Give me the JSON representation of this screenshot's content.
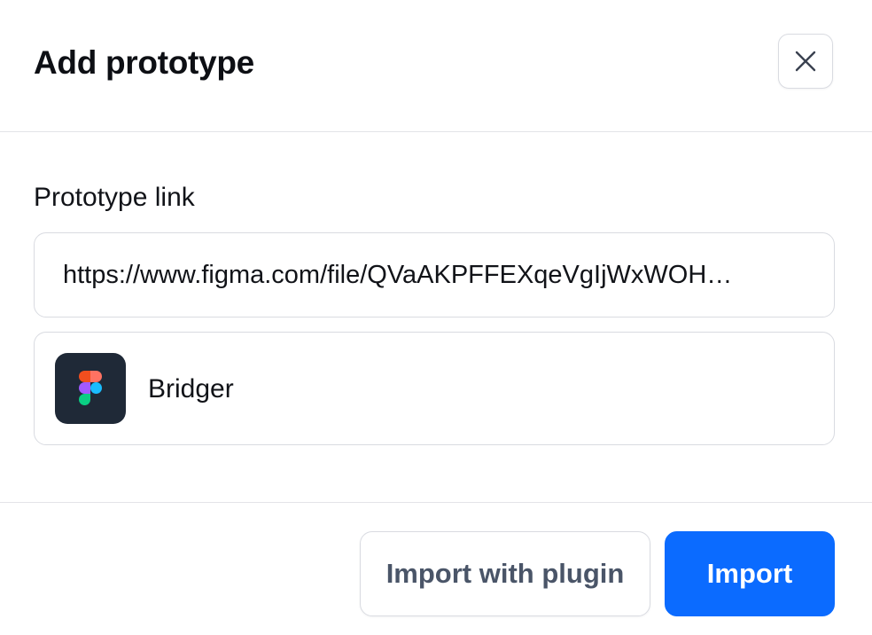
{
  "dialog": {
    "title": "Add prototype",
    "close_icon": "close-icon"
  },
  "form": {
    "link_label": "Prototype link",
    "link_value": "https://www.figma.com/file/QVaAKPFFEXqeVgIjWxWOH…",
    "link_placeholder": ""
  },
  "file": {
    "app_icon": "figma-icon",
    "name": "Bridger"
  },
  "footer": {
    "secondary_label": "Import with plugin",
    "primary_label": "Import"
  },
  "colors": {
    "primary": "#0b6bff",
    "icon_tile": "#1f2937",
    "border": "#d9dbe1",
    "figma_red": "#f24e1e",
    "figma_orange": "#ff7262",
    "figma_purple": "#a259ff",
    "figma_blue": "#1abcfe",
    "figma_green": "#0acf83"
  }
}
